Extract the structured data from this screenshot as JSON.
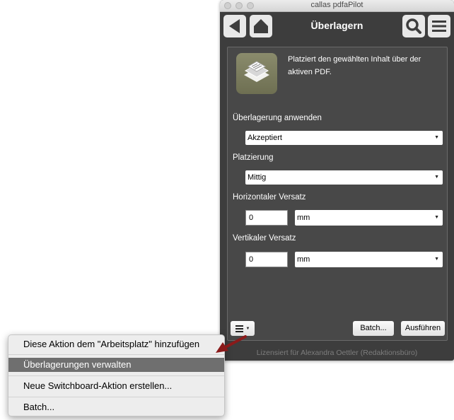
{
  "window": {
    "title": "callas pdfaPilot",
    "toolbar_title": "Überlagern",
    "description": "Platziert den gewählten Inhalt über der aktiven PDF.",
    "fields": {
      "overlay_label": "Überlagerung anwenden",
      "overlay_value": "Akzeptiert",
      "placement_label": "Platzierung",
      "placement_value": "Mittig",
      "h_offset_label": "Horizontaler Versatz",
      "h_offset_value": "0",
      "h_offset_unit": "mm",
      "v_offset_label": "Vertikaler Versatz",
      "v_offset_value": "0",
      "v_offset_unit": "mm"
    },
    "buttons": {
      "batch": "Batch...",
      "run": "Ausführen"
    },
    "license": "Lizensiert für Alexandra Oettler (Redaktionsbüro)"
  },
  "context_menu": {
    "items": [
      "Diese Aktion dem \"Arbeitsplatz\" hinzufügen",
      "Überlagerungen verwalten",
      "Neue Switchboard-Aktion erstellen...",
      "Batch..."
    ],
    "selected_index": 1
  },
  "colors": {
    "window_bg": "#3d3d3d",
    "panel_bg": "#484848",
    "icon_bg": "#7d7e60",
    "menu_highlight": "#6f6f6f",
    "pointer_arrow": "#8b1a1a"
  },
  "icons": [
    "back-arrow-icon",
    "home-icon",
    "search-icon",
    "hamburger-menu-icon",
    "overlay-pages-icon",
    "dropdown-arrow-icon"
  ]
}
